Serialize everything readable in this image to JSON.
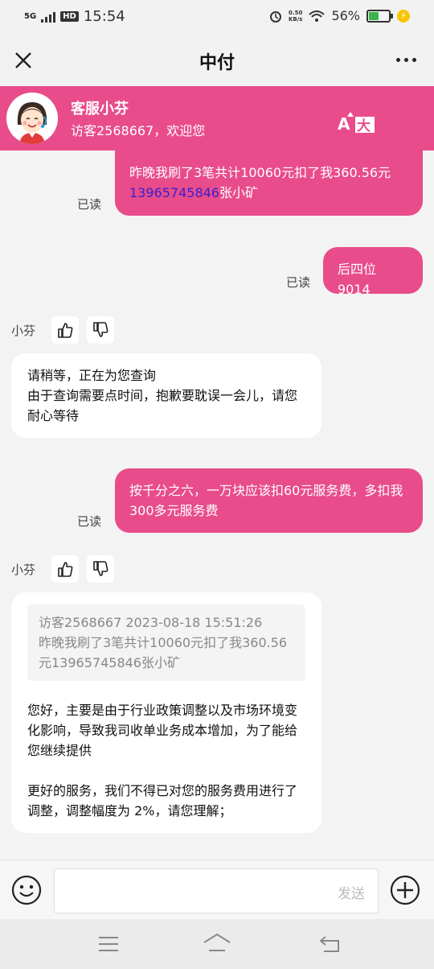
{
  "status_bar": {
    "network": "5G",
    "hd": "HD",
    "time": "15:54",
    "net_speed_value": "0.50",
    "net_speed_unit": "KB/s",
    "battery_percent": "56%",
    "battery_level": 0.56
  },
  "title_bar": {
    "title": "中付"
  },
  "agent": {
    "name": "客服小芬",
    "welcome": "访客2568667，欢迎您",
    "font_size_icon": "text-size-icon"
  },
  "messages": {
    "m1": {
      "line1": "昨晚我刷了3笔共计10060元扣了我360.56元",
      "phone": "13965745846",
      "suffix": "张小矿",
      "status": "已读"
    },
    "m2": {
      "text": "后四位9014",
      "status": "已读"
    },
    "r1": {
      "sender": "小芬",
      "line1": "请稍等，正在为您查询",
      "line2": "由于查询需要点时间，抱歉要耽误一会儿，请您耐心等待"
    },
    "m3": {
      "text": "按千分之六，一万块应该扣60元服务费，多扣我300多元服务费",
      "status": "已读"
    },
    "r2": {
      "sender": "小芬",
      "quote_header": "访客2568667 2023-08-18 15:51:26",
      "quote_body": "昨晚我刷了3笔共计10060元扣了我360.56元13965745846张小矿",
      "para1": "您好，主要是由于行业政策调整以及市场环境变化影响，导致我司收单业务成本增加，为了能给您继续提供",
      "para2": "更好的服务，我们不得已对您的服务费用进行了调整，调整幅度为 2%，请您理解；"
    }
  },
  "input_bar": {
    "send_label": "发送",
    "placeholder": ""
  },
  "colors": {
    "accent": "#e84c8b",
    "link": "#3a1fd1"
  }
}
